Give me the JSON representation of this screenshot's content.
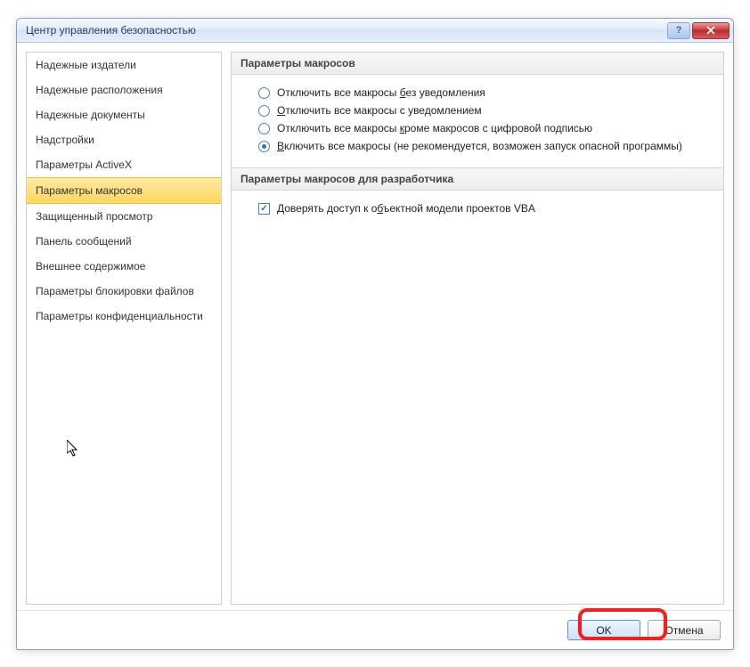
{
  "window": {
    "title": "Центр управления безопасностью"
  },
  "sidebar": {
    "items": [
      "Надежные издатели",
      "Надежные расположения",
      "Надежные документы",
      "Надстройки",
      "Параметры ActiveX",
      "Параметры макросов",
      "Защищенный просмотр",
      "Панель сообщений",
      "Внешнее содержимое",
      "Параметры блокировки файлов",
      "Параметры конфиденциальности"
    ],
    "selectedIndex": 5
  },
  "main": {
    "section1_title": "Параметры макросов",
    "radios": [
      {
        "pre": "Отключить все макросы ",
        "u": "б",
        "post": "ез уведомления",
        "checked": false
      },
      {
        "pre": "",
        "u": "О",
        "post": "тключить все макросы с уведомлением",
        "checked": false
      },
      {
        "pre": "Отключить все макросы ",
        "u": "к",
        "post": "роме макросов с цифровой подписью",
        "checked": false
      },
      {
        "pre": "",
        "u": "В",
        "post": "ключить все макросы (не рекомендуется, возможен запуск опасной программы)",
        "checked": true
      }
    ],
    "section2_title": "Параметры макросов для разработчика",
    "checkbox": {
      "pre": "Доверять доступ к о",
      "u": "б",
      "post": "ъектной модели проектов VBA",
      "checked": true
    }
  },
  "buttons": {
    "ok": "OK",
    "cancel": "Отмена"
  }
}
